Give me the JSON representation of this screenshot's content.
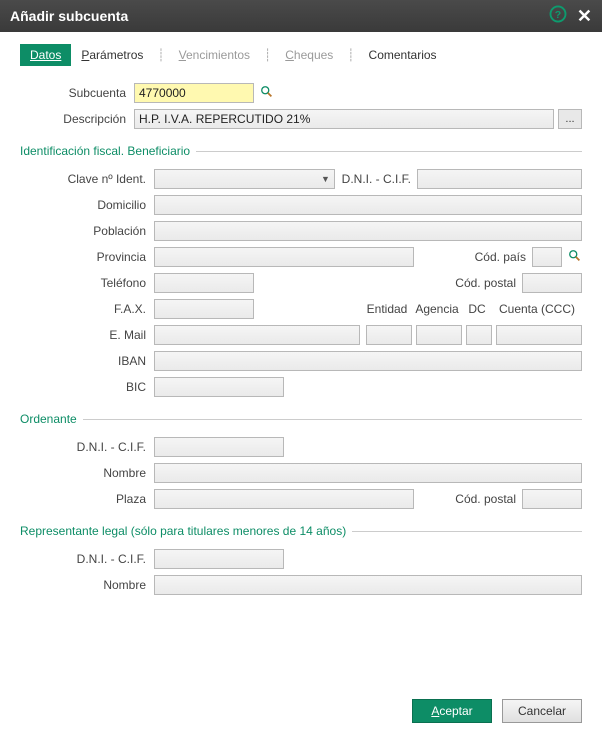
{
  "window": {
    "title": "Añadir subcuenta"
  },
  "tabs": {
    "datos": "Datos",
    "parametros": "Parámetros",
    "vencimientos": "Vencimientos",
    "cheques": "Cheques",
    "comentarios": "Comentarios"
  },
  "main": {
    "subcuenta_label": "Subcuenta",
    "subcuenta_value": "4770000",
    "descripcion_label": "Descripción",
    "descripcion_value": "H.P. I.V.A. REPERCUTIDO 21%",
    "more_label": "..."
  },
  "fiscal": {
    "section_title": "Identificación fiscal. Beneficiario",
    "clave_label": "Clave nº Ident.",
    "dni_label": "D.N.I. - C.I.F.",
    "domicilio_label": "Domicilio",
    "poblacion_label": "Población",
    "provincia_label": "Provincia",
    "cod_pais_label": "Cód. país",
    "telefono_label": "Teléfono",
    "cod_postal_label": "Cód. postal",
    "fax_label": "F.A.X.",
    "entidad_label": "Entidad",
    "agencia_label": "Agencia",
    "dc_label": "DC",
    "cuenta_label": "Cuenta (CCC)",
    "email_label": "E. Mail",
    "iban_label": "IBAN",
    "bic_label": "BIC"
  },
  "ordenante": {
    "section_title": "Ordenante",
    "dni_label": "D.N.I. - C.I.F.",
    "nombre_label": "Nombre",
    "plaza_label": "Plaza",
    "cod_postal_label": "Cód. postal"
  },
  "representante": {
    "section_title": "Representante legal (sólo para titulares menores de 14 años)",
    "dni_label": "D.N.I. - C.I.F.",
    "nombre_label": "Nombre"
  },
  "footer": {
    "aceptar": "Aceptar",
    "cancelar": "Cancelar"
  }
}
